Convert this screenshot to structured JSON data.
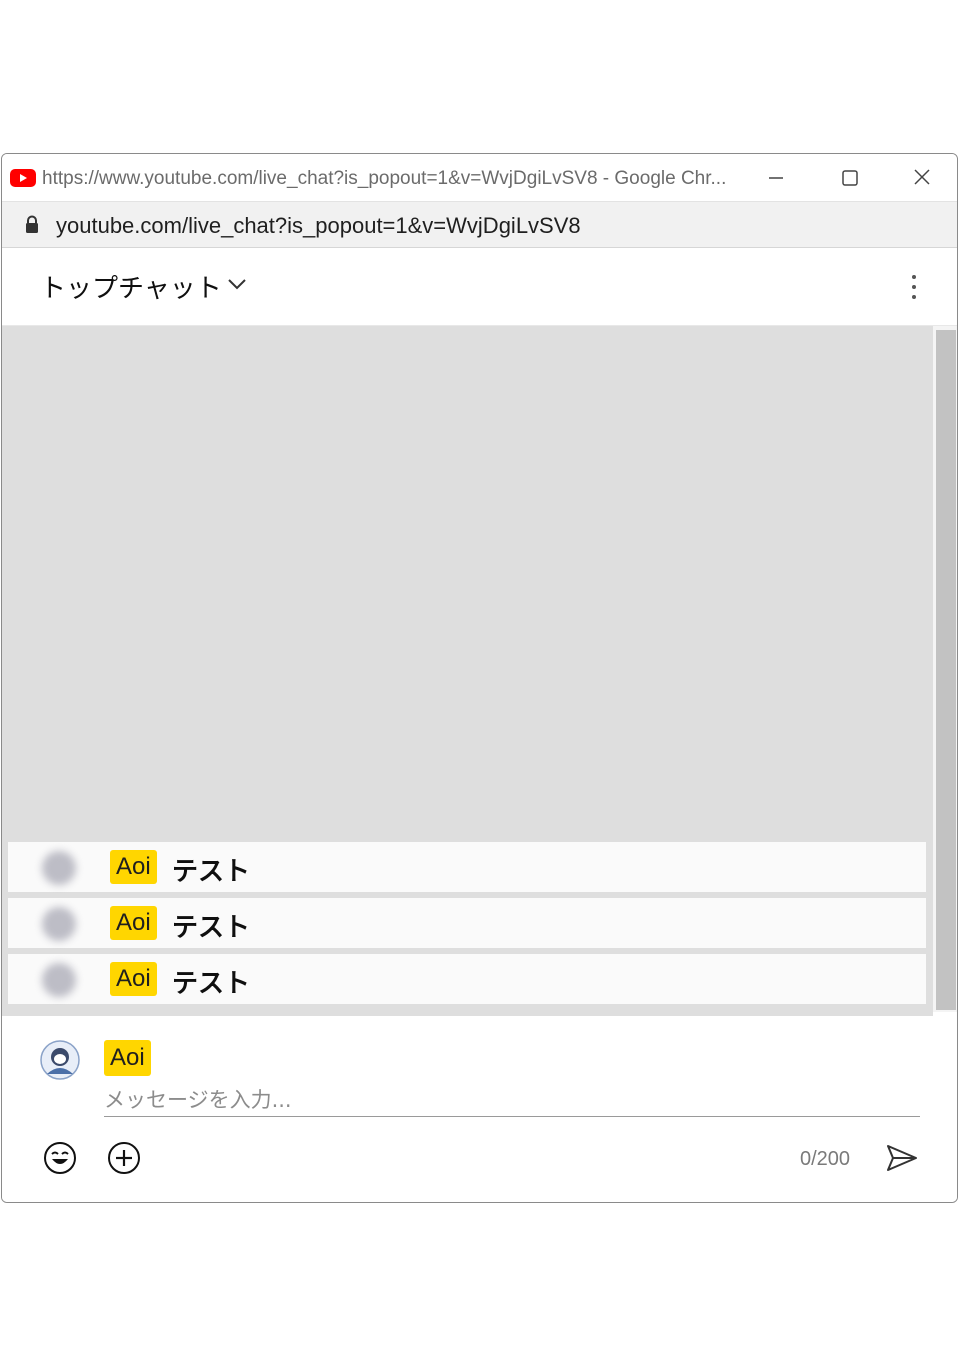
{
  "window": {
    "title": "https://www.youtube.com/live_chat?is_popout=1&v=WvjDgiLvSV8 - Google Chr...",
    "address": "youtube.com/live_chat?is_popout=1&v=WvjDgiLvSV8",
    "brand_color": "#ff0000"
  },
  "chat": {
    "mode_label": "トップチャット",
    "messages": [
      {
        "author": "Aoi",
        "text": "テスト"
      },
      {
        "author": "Aoi",
        "text": "テスト"
      },
      {
        "author": "Aoi",
        "text": "テスト"
      }
    ],
    "badge_color": "#ffd600"
  },
  "composer": {
    "author": "Aoi",
    "placeholder": "メッセージを入力...",
    "char_count": "0/200"
  }
}
